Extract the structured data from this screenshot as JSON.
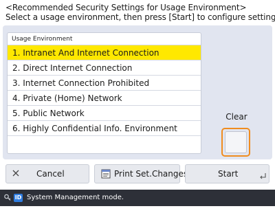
{
  "header": {
    "title": "<Recommended Security Settings for Usage Environment>",
    "instruction": "Select a usage environment, then press [Start] to configure settings."
  },
  "list": {
    "column_header": "Usage Environment",
    "selected_index": 0,
    "items": [
      "1. Intranet And Internet Connection",
      "2. Direct Internet Connection",
      "3. Internet Connection Prohibited",
      "4. Private (Home) Network",
      "5. Public Network",
      "6. Highly Confidential Info. Environment"
    ]
  },
  "clear": {
    "label": "Clear"
  },
  "buttons": {
    "cancel": {
      "label": "Cancel",
      "icon": "close-icon"
    },
    "print": {
      "label": "Print Set.Changes",
      "icon": "printer-icon"
    },
    "start": {
      "label": "Start",
      "icon": "enter-icon"
    }
  },
  "status_bar": {
    "id_badge": "ID",
    "message": "System Management mode."
  },
  "colors": {
    "selected_row": "#ffe800",
    "clear_border": "#f08c1e",
    "status_bar": "#2d3038",
    "id_badge": "#2f7de1"
  }
}
